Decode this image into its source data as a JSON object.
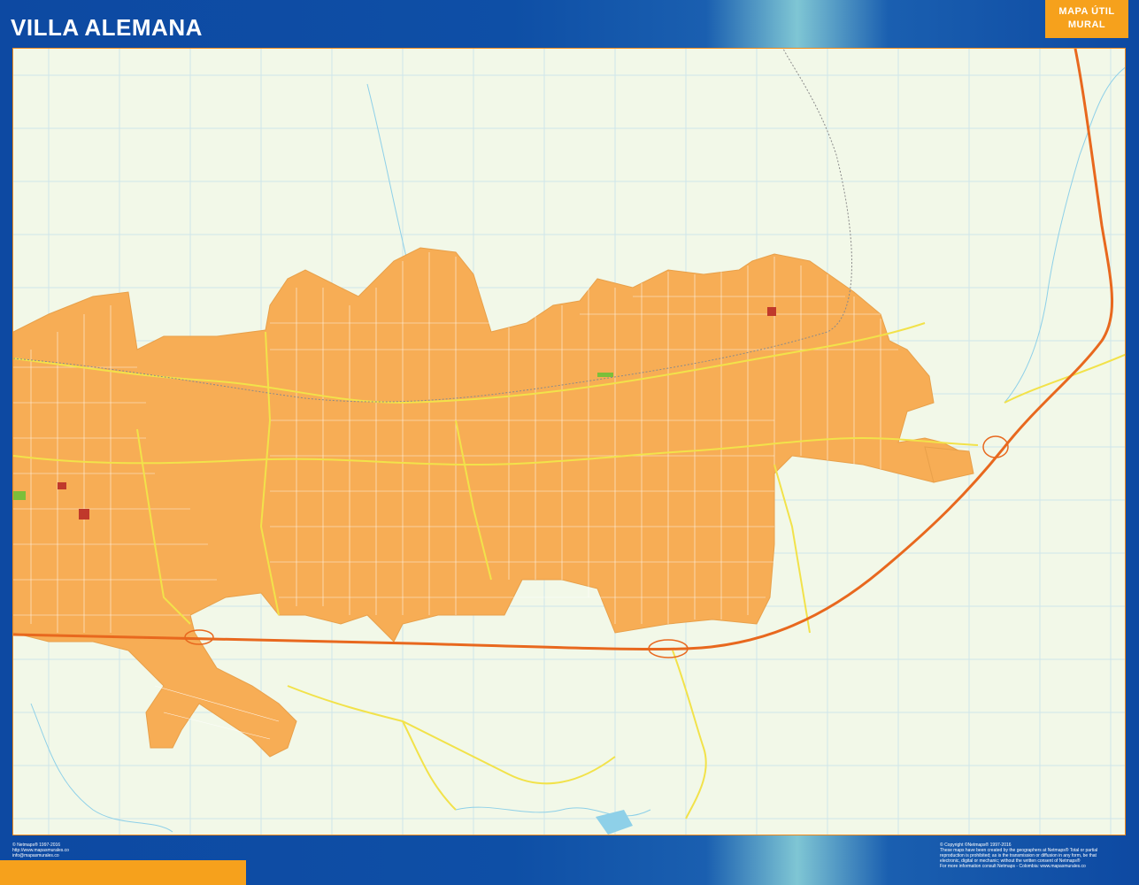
{
  "header": {
    "title": "VILLA ALEMANA",
    "badge_line1": "MAPA ÚTIL",
    "badge_line2": "MURAL"
  },
  "footer": {
    "left_copyright": "© Netmaps® 1997-2016",
    "left_url": "http://www.mapasmurales.co",
    "left_email": "info@mapasmurales.co",
    "right_line1": "© Copyright ©Netmaps® 1997-2016",
    "right_line2": "These maps have been created by the geographers at Netmaps® Total or partial",
    "right_line3": "reproduction is prohibited; as is the transmission or diffusion in any form, be that",
    "right_line4": "electronic, digital or mechanic; without the written consent of Netmaps®",
    "right_line5": "For more information consult Netmaps - Colombia: www.mapasmurales.co"
  },
  "colors": {
    "frame_blue": "#0d49a2",
    "accent_orange": "#f6a11c",
    "urban_area": "#f7ad55",
    "map_background": "#f2f8e8",
    "highway": "#e8681e",
    "main_road": "#f2e24a"
  }
}
